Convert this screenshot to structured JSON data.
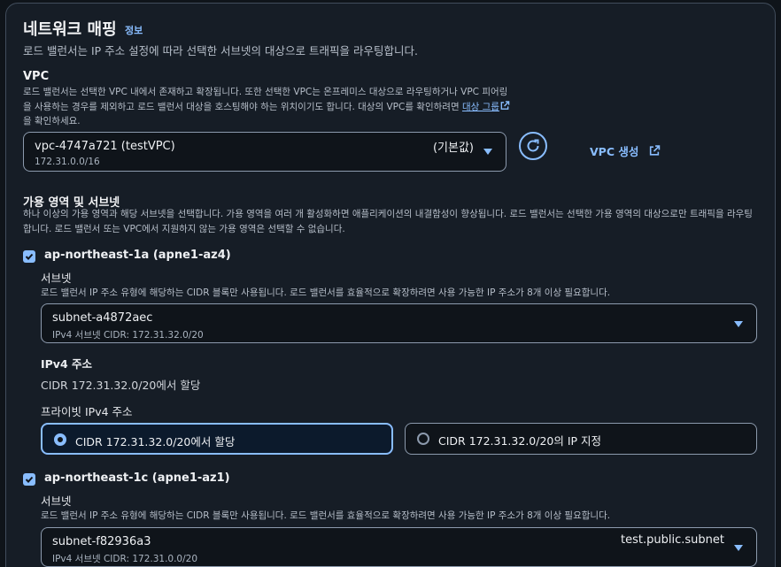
{
  "section": {
    "title": "네트워크 매핑",
    "info_link": "정보",
    "description": "로드 밸런서는 IP 주소 설정에 따라 선택한 서브넷의 대상으로 트래픽을 라우팅합니다."
  },
  "vpc": {
    "label": "VPC",
    "desc_part1": "로드 밸런서는 선택한 VPC 내에서 존재하고 확장됩니다. 또한 선택한 VPC는 온프레미스 대상으로 라우팅하거나 VPC 피어링을 사용하는 경우를 제외하고 로드 밸런서 대상을 호스팅해야 하는 위치이기도 합니다. 대상의 VPC를 확인하려면",
    "desc_link": "대상 그룹",
    "desc_part2": "을 확인하세요.",
    "selected": "vpc-4747a721 (testVPC)",
    "selected_tag": "(기본값)",
    "selected_cidr": "172.31.0.0/16",
    "create_label": "VPC 생성"
  },
  "az": {
    "label": "가용 영역 및 서브넷",
    "description": "하나 이상의 가용 영역과 해당 서브넷을 선택합니다. 가용 영역을 여러 개 활성화하면 애플리케이션의 내결함성이 향상됩니다. 로드 밸런서는 선택한 가용 영역의 대상으로만 트래픽을 라우팅합니다. 로드 밸런서 또는 VPC에서 지원하지 않는 가용 영역은 선택할 수 없습니다.",
    "zones": [
      {
        "name": "ap-northeast-1a (apne1-az4)",
        "subnet_label": "서브넷",
        "subnet_desc": "로드 밸런서 IP 주소 유형에 해당하는 CIDR 블록만 사용됩니다. 로드 밸런서를 효율적으로 확장하려면 사용 가능한 IP 주소가 8개 이상 필요합니다.",
        "subnet_id": "subnet-a4872aec",
        "subnet_cidr": "IPv4 서브넷 CIDR: 172.31.32.0/20",
        "ipv4_label": "IPv4 주소",
        "ipv4_value": "CIDR 172.31.32.0/20에서 할당",
        "private_label": "프라이빗 IPv4 주소",
        "option_assign": "CIDR 172.31.32.0/20에서 할당",
        "option_specify": "CIDR 172.31.32.0/20의 IP 지정"
      },
      {
        "name": "ap-northeast-1c (apne1-az1)",
        "subnet_label": "서브넷",
        "subnet_desc": "로드 밸런서 IP 주소 유형에 해당하는 CIDR 블록만 사용됩니다. 로드 밸런서를 효율적으로 확장하려면 사용 가능한 IP 주소가 8개 이상 필요합니다.",
        "subnet_id": "subnet-f82936a3",
        "subnet_name": "test.public.subnet",
        "subnet_cidr": "IPv4 서브넷 CIDR: 172.31.0.0/20"
      }
    ]
  },
  "colors": {
    "accent": "#89bdff",
    "panel_bg": "#161d26",
    "page_bg": "#0f141a",
    "border": "#8c9aad"
  }
}
